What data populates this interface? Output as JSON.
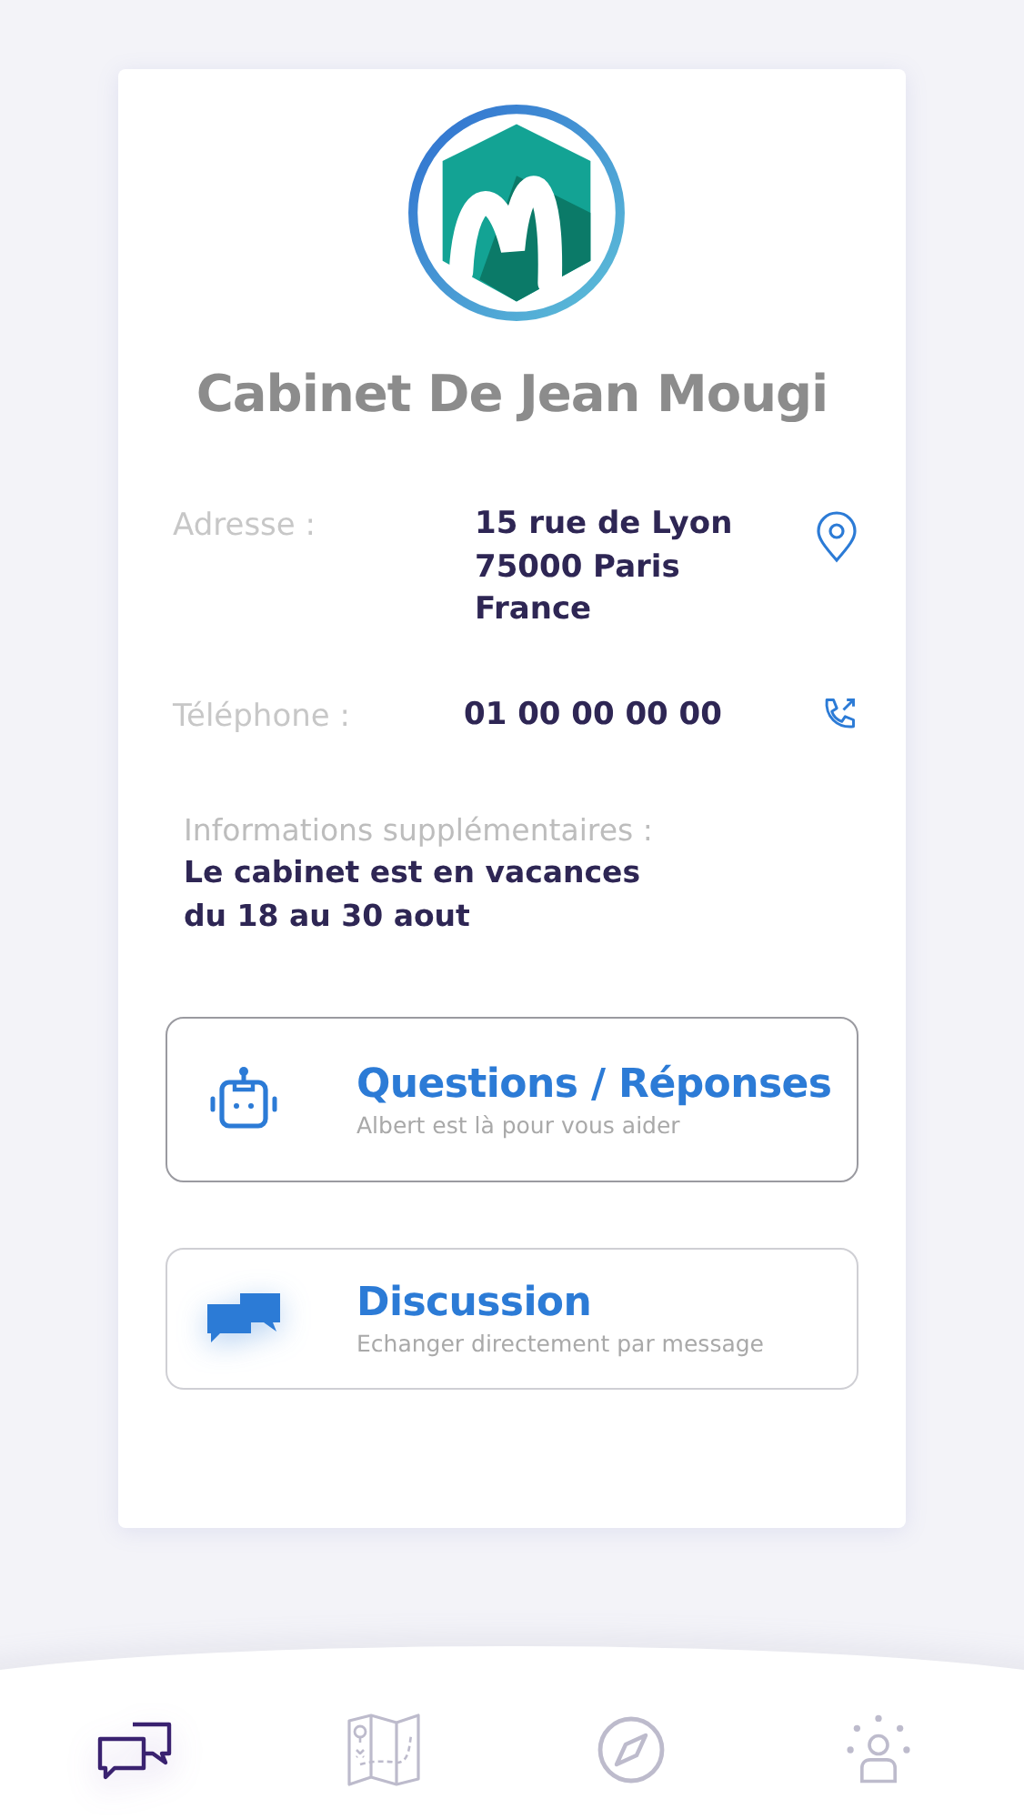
{
  "clinic": {
    "name": "Cabinet De Jean Mougi"
  },
  "details": [
    {
      "kind": "address",
      "label": "Adresse :",
      "lines": [
        "15 rue de Lyon",
        "75000 Paris",
        "France"
      ]
    },
    {
      "kind": "phone",
      "label": "Téléphone :",
      "lines": [
        "01 00 00 00 00"
      ]
    }
  ],
  "extra_info": {
    "label": "Informations supplémentaires :",
    "lines": [
      "Le cabinet est en vacances",
      "du 18 au 30 aout"
    ]
  },
  "actions": [
    {
      "kind": "robot",
      "title": "Questions / Réponses",
      "subtitle": "Albert est là pour vous aider"
    },
    {
      "kind": "chat",
      "title": "Discussion",
      "subtitle": "Echanger directement par message"
    }
  ],
  "bottom_nav": [
    {
      "kind": "chat",
      "selected": true
    },
    {
      "kind": "map",
      "selected": false
    },
    {
      "kind": "compass",
      "selected": false
    },
    {
      "kind": "people",
      "selected": false
    }
  ]
}
